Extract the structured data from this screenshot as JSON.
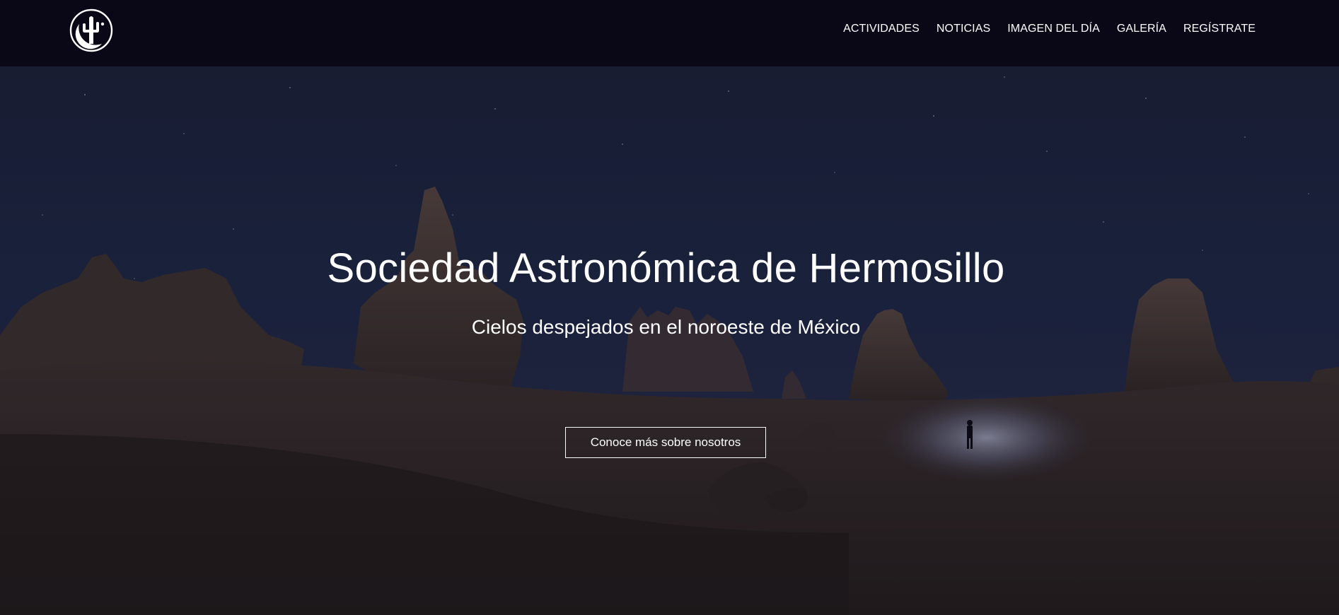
{
  "header": {
    "logo_icon": "cactus-moon-logo-icon",
    "nav": [
      {
        "label": "ACTIVIDADES"
      },
      {
        "label": "NOTICIAS"
      },
      {
        "label": "IMAGEN DEL DÍA"
      },
      {
        "label": "GALERÍA"
      },
      {
        "label": "REGÍSTRATE"
      }
    ]
  },
  "hero": {
    "title": "Sociedad Astronómica de Hermosillo",
    "subtitle": "Cielos despejados en el noroeste de México",
    "cta_label": "Conoce más sobre nosotros",
    "background": "night-desert-rock-formations-photo"
  },
  "colors": {
    "header_bg": "#0a0717",
    "sky_top": "#1c2340",
    "ground": "#2e2625",
    "text": "#ffffff"
  }
}
